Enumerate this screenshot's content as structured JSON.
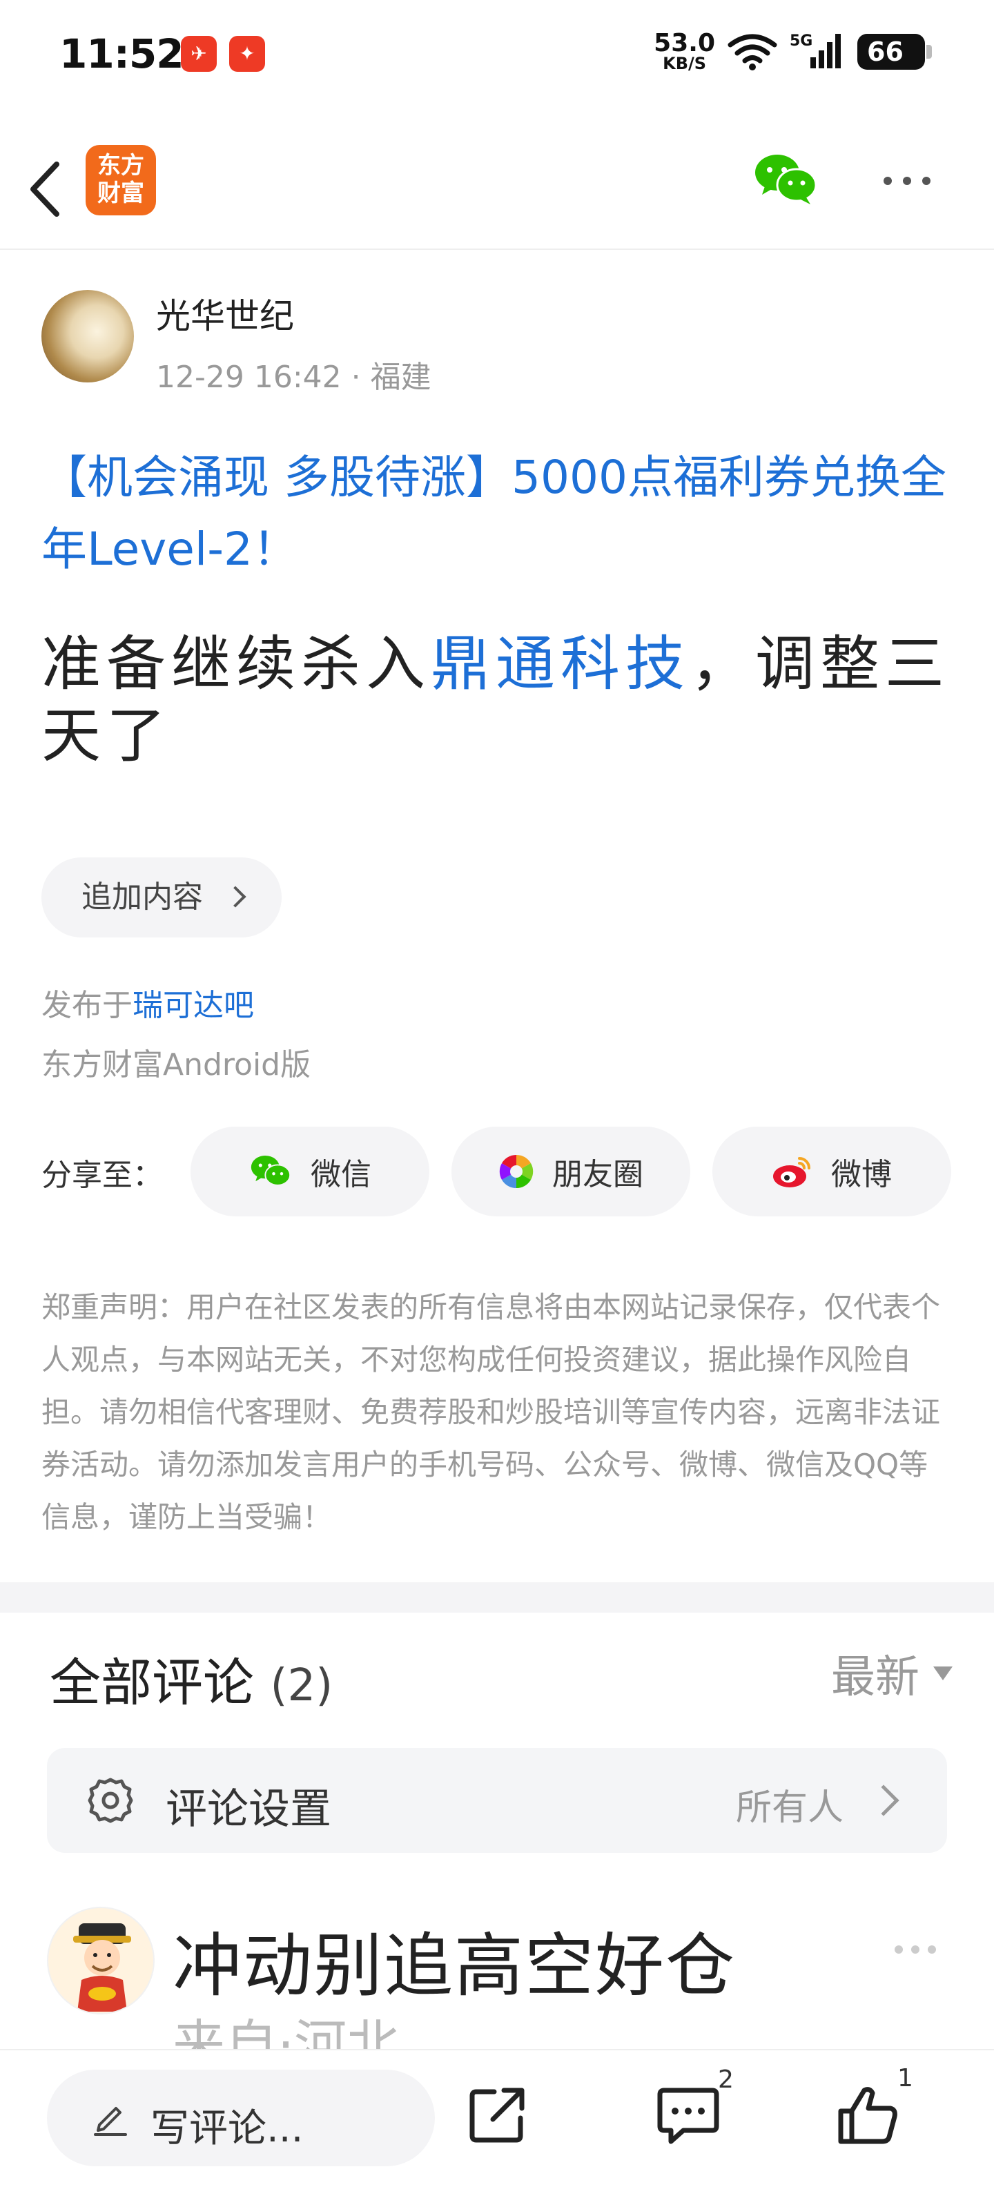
{
  "status_bar": {
    "time": "11:52",
    "net_speed_value": "53.0",
    "net_speed_unit": "KB/S",
    "network": "5G",
    "battery": "66"
  },
  "nav": {
    "logo_text_line1": "东方",
    "logo_text_line2": "财富"
  },
  "post": {
    "author": "光华世纪",
    "time": "12-29 16:42",
    "location": "· 福建",
    "promo_title": "【机会涌现 多股待涨】5000点福利券兑换全年Level-2！",
    "body_before": "准备继续杀入",
    "body_stock": "鼎通科技",
    "body_after": "，调整三天了",
    "addon_label": "追加内容",
    "published_prefix": "发布于",
    "published_bar": "瑞可达吧",
    "client": "东方财富Android版"
  },
  "share": {
    "label": "分享至：",
    "wechat": "微信",
    "moments": "朋友圈",
    "weibo": "微博"
  },
  "disclaimer": "郑重声明：用户在社区发表的所有信息将由本网站记录保存，仅代表个人观点，与本网站无关，不对您构成任何投资建议，据此操作风险自担。请勿相信代客理财、免费荐股和炒股培训等宣传内容，远离非法证券活动。请勿添加发言用户的手机号码、公众号、微博、微信及QQ等信息，谨防上当受骗！",
  "comments": {
    "title": "全部评论",
    "count": "(2)",
    "sort": "最新",
    "settings_label": "评论设置",
    "settings_value": "所有人",
    "first_author": "冲动别追高空好仓",
    "first_location": "来自·河北"
  },
  "bottom_bar": {
    "write_placeholder": "写评论...",
    "comment_count": "2",
    "like_count": "1"
  },
  "colors": {
    "link_blue": "#1d6fd6",
    "brand_orange": "#f26a1b",
    "wechat_green": "#2dc100",
    "weibo_red": "#e6162d"
  }
}
